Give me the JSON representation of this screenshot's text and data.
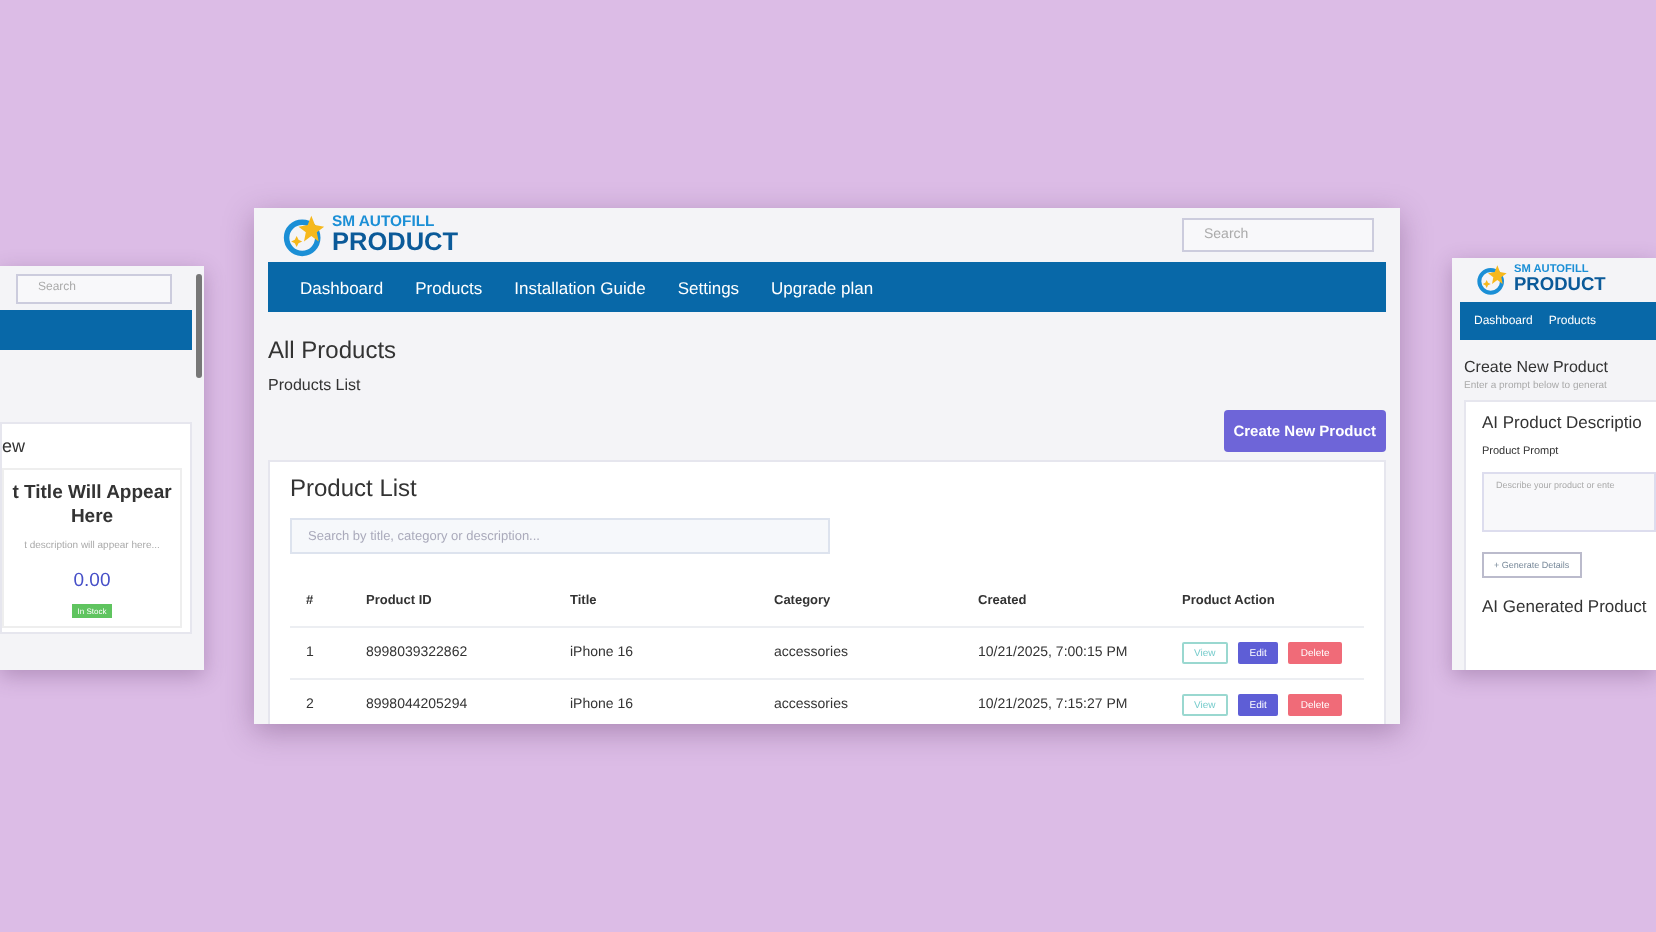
{
  "left_window": {
    "search": {
      "placeholder": "Search"
    },
    "preview": {
      "heading": "ew",
      "title": "t Title Will Appear Here",
      "description": "t description will appear here...",
      "price": "0.00",
      "badge": "In Stock"
    }
  },
  "main_window": {
    "logo": {
      "line1": "SM AUTOFILL",
      "line2": "PRODUCT"
    },
    "search": {
      "placeholder": "Search"
    },
    "nav": [
      {
        "label": "Dashboard"
      },
      {
        "label": "Products"
      },
      {
        "label": "Installation Guide"
      },
      {
        "label": "Settings"
      },
      {
        "label": "Upgrade plan"
      }
    ],
    "page_title": "All Products",
    "breadcrumb": "Products List",
    "create_button": "Create New Product",
    "card": {
      "title": "Product List",
      "search": {
        "placeholder": "Search by title, category or description..."
      },
      "columns": [
        "#",
        "Product ID",
        "Title",
        "Category",
        "Created",
        "Product Action"
      ],
      "rows": [
        {
          "cells": [
            "1",
            "8998039322862",
            "iPhone 16",
            "accessories",
            "10/21/2025, 7:00:15 PM"
          ],
          "actions": [
            {
              "kind": "view",
              "label": "View"
            },
            {
              "kind": "edit",
              "label": "Edit"
            },
            {
              "kind": "delete",
              "label": "Delete"
            }
          ]
        },
        {
          "cells": [
            "2",
            "8998044205294",
            "iPhone 16",
            "accessories",
            "10/21/2025, 7:15:27 PM"
          ],
          "actions": [
            {
              "kind": "view",
              "label": "View"
            },
            {
              "kind": "edit",
              "label": "Edit"
            },
            {
              "kind": "delete",
              "label": "Delete"
            }
          ]
        }
      ]
    }
  },
  "right_window": {
    "logo": {
      "line1": "SM AUTOFILL",
      "line2": "PRODUCT"
    },
    "nav": [
      {
        "label": "Dashboard"
      },
      {
        "label": "Products"
      }
    ],
    "page_title": "Create New Product",
    "subtitle": "Enter a prompt below to generat",
    "card_title": "AI Product Descriptio",
    "prompt_label": "Product Prompt",
    "prompt_placeholder": "Describe your product or ente",
    "generate_button": "+ Generate Details",
    "generated_title": "AI Generated Product"
  }
}
